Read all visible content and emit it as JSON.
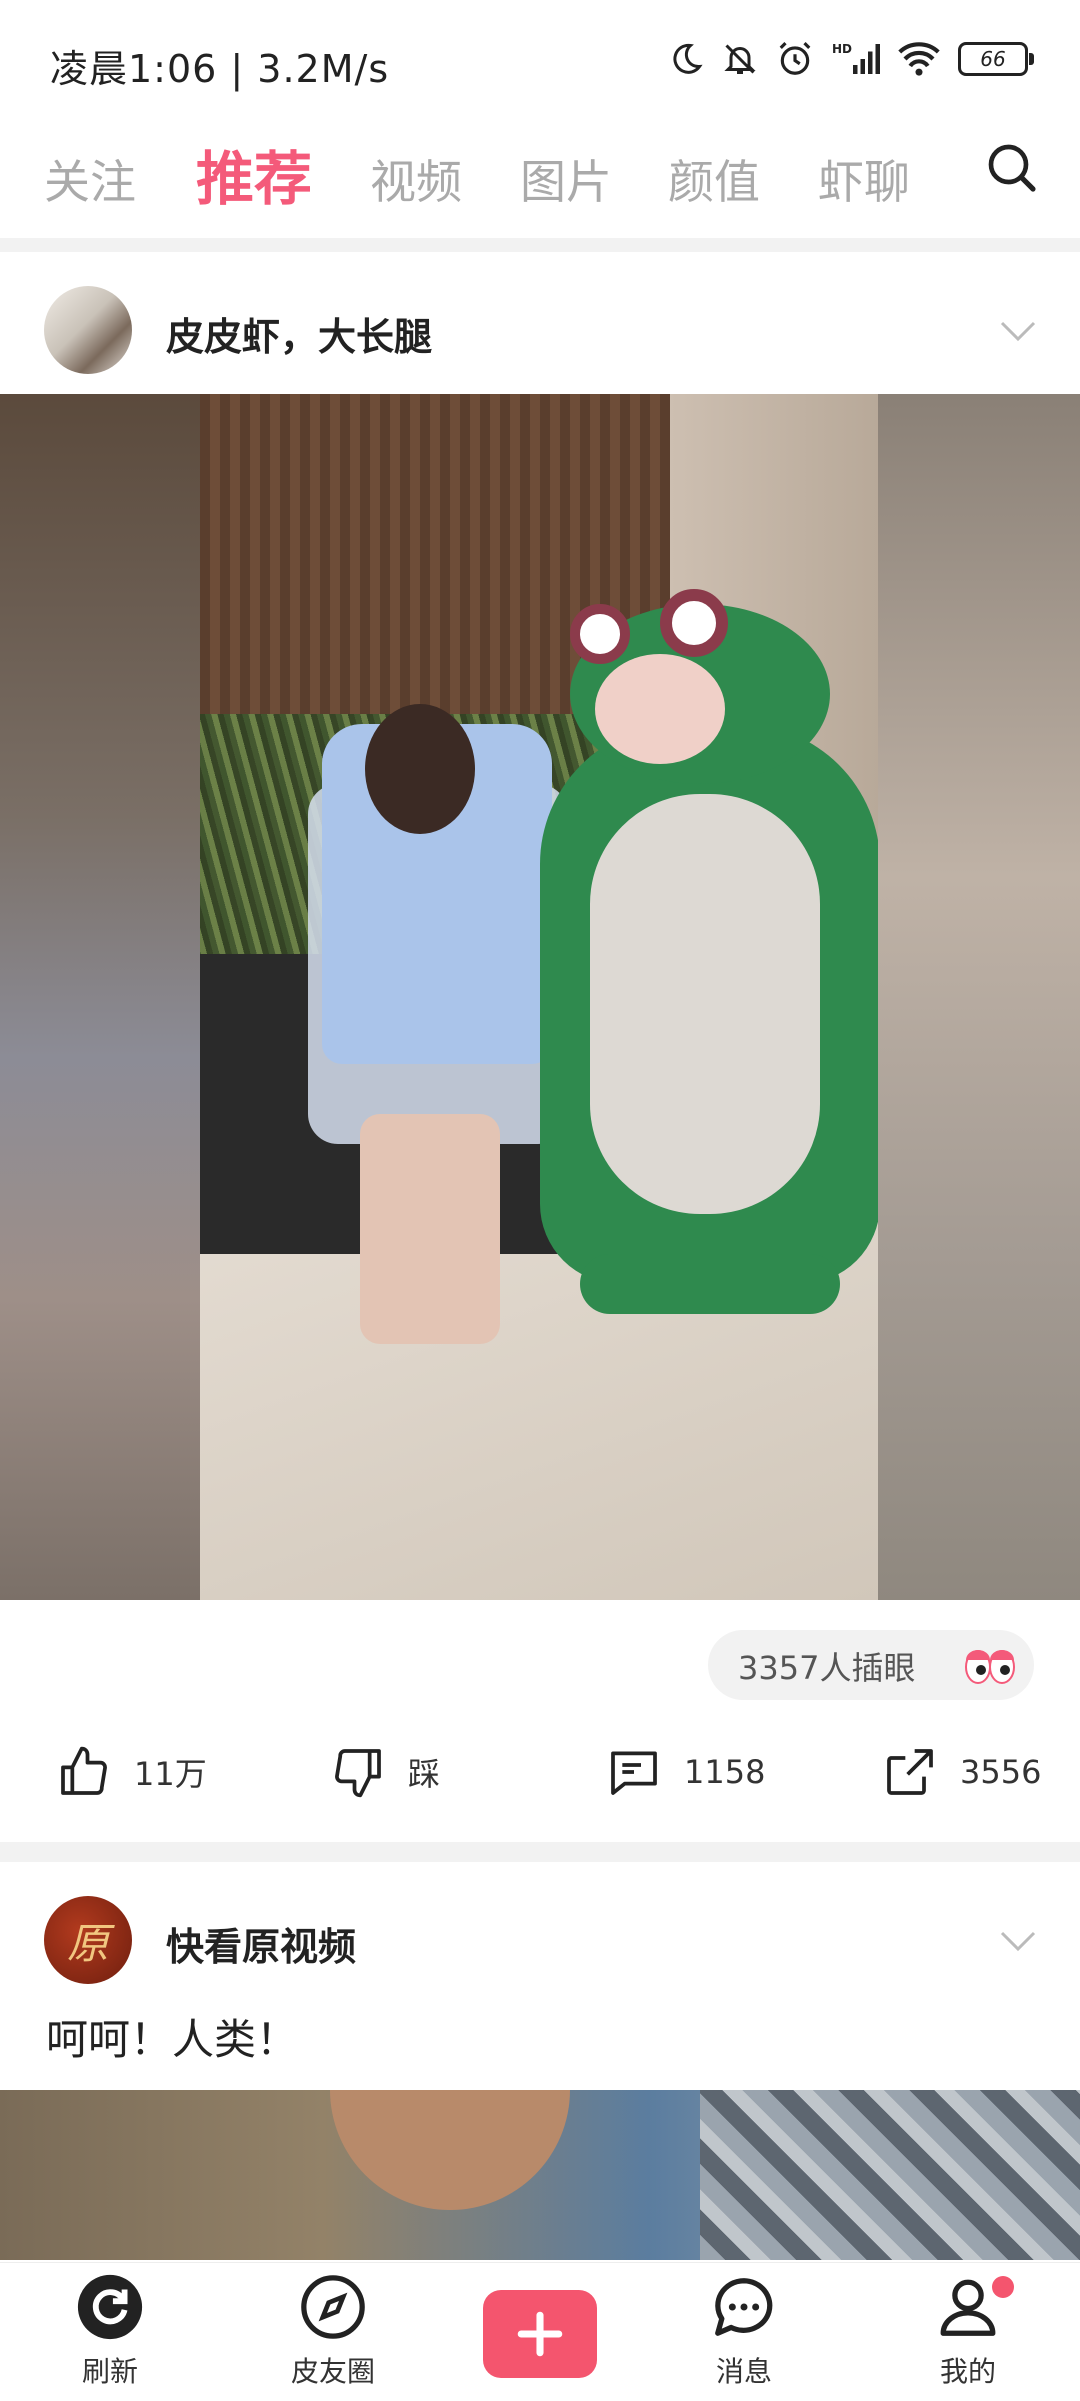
{
  "status_bar": {
    "time": "凌晨1:06 | 3.2M/s",
    "battery": "66"
  },
  "tabs": [
    {
      "label": "关注",
      "active": false
    },
    {
      "label": "推荐",
      "active": true
    },
    {
      "label": "视频",
      "active": false
    },
    {
      "label": "图片",
      "active": false
    },
    {
      "label": "颜值",
      "active": false
    },
    {
      "label": "虾聊",
      "active": false
    }
  ],
  "post1": {
    "username": "皮皮虾，大长腿",
    "views": "3357人插眼",
    "actions": {
      "like": "11万",
      "dislike": "踩",
      "comment": "1158",
      "share": "3556"
    }
  },
  "post2": {
    "username": "快看原视频",
    "avatar_char": "原",
    "caption": "呵呵！人类！"
  },
  "bottom_nav": [
    {
      "label": "刷新",
      "icon": "refresh-icon"
    },
    {
      "label": "皮友圈",
      "icon": "compass-icon"
    },
    {
      "label": "",
      "icon": "plus-icon"
    },
    {
      "label": "消息",
      "icon": "message-icon"
    },
    {
      "label": "我的",
      "icon": "profile-icon"
    }
  ],
  "colors": {
    "accent": "#f45a7a",
    "inactive_tab": "#aaaaaa"
  }
}
